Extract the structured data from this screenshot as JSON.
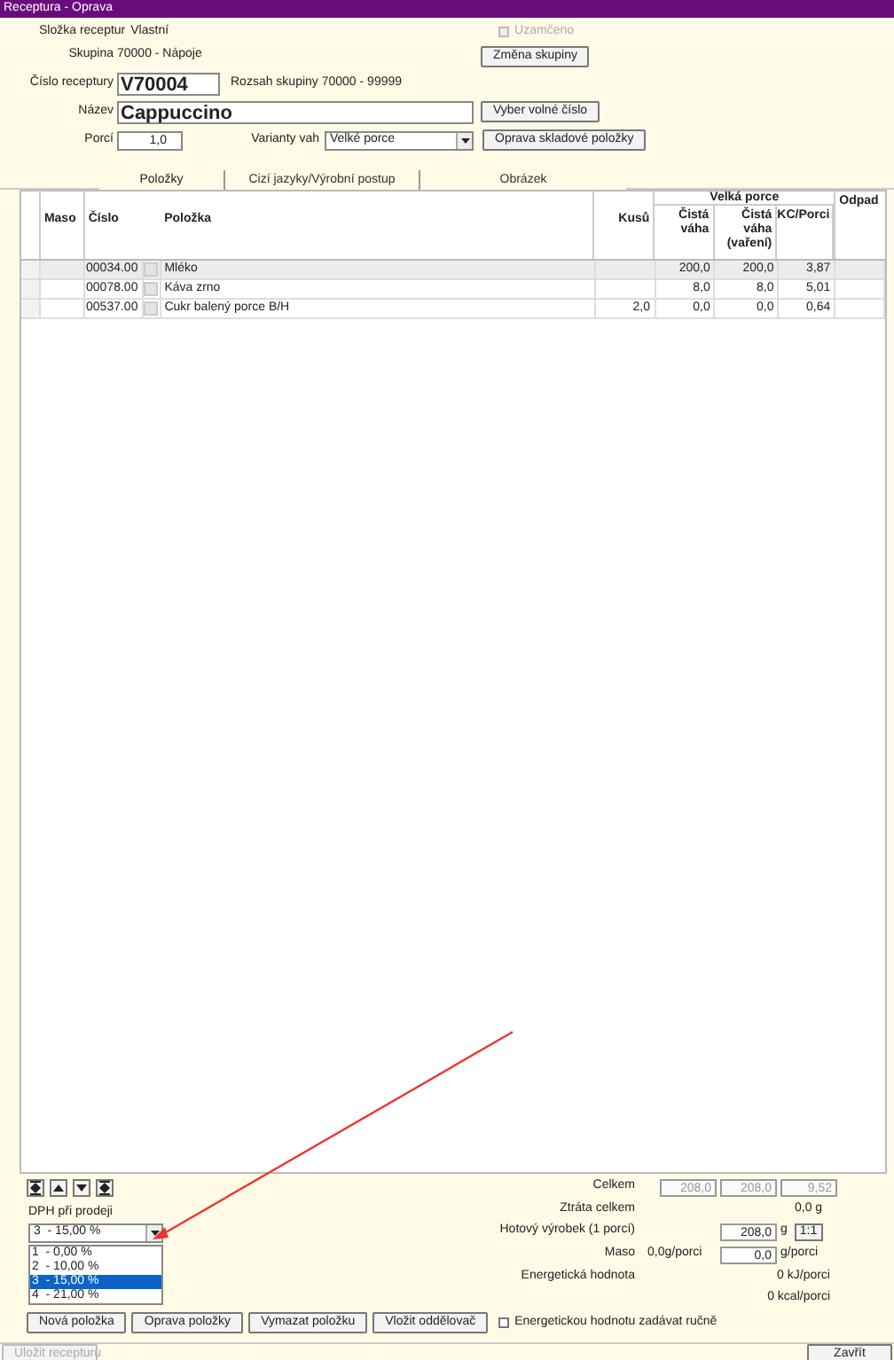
{
  "window": {
    "title": "Receptura - Oprava"
  },
  "header": {
    "folder_label": "Složka receptur",
    "folder_value": "Vlastní",
    "locked": {
      "label": "Uzamčeno",
      "checked": false,
      "disabled": true
    },
    "group_label": "Skupina",
    "group_value": "70000 - Nápoje",
    "change_group_button": "Změna skupiny",
    "number_label": "Číslo receptury",
    "number_value": "V70004",
    "range_text": "Rozsah skupiny 70000 - 99999",
    "name_label": "Název",
    "name_value": "Cappuccino",
    "free_number_button": "Vyber volné číslo",
    "portions_label": "Porcí",
    "portions_value": "1,0",
    "variants_label": "Varianty vah",
    "variants_value": "Velké porce",
    "stock_item_button": "Oprava skladové položky"
  },
  "tabs": [
    {
      "label": "Položky",
      "selected": true
    },
    {
      "label": "Cizí jazyky/Výrobní postup",
      "selected": false
    },
    {
      "label": "Obrázek",
      "selected": false
    }
  ],
  "table": {
    "group_header": "Velká porce",
    "columns": [
      "Maso",
      "Číslo",
      "Položka",
      "Kusů",
      "Čistá váha",
      "Čistá váha (vaření)",
      "KC/Porci",
      "Odpad"
    ],
    "rows": [
      {
        "number": "00034.00",
        "item": "Mléko",
        "pieces": "",
        "net": "200,0",
        "net_cooked": "200,0",
        "kc": "3,87",
        "selected": true
      },
      {
        "number": "00078.00",
        "item": "Káva zrno",
        "pieces": "",
        "net": "8,0",
        "net_cooked": "8,0",
        "kc": "5,01",
        "selected": false
      },
      {
        "number": "00537.00",
        "item": "Cukr balený porce B/H",
        "pieces": "2,0",
        "net": "0,0",
        "net_cooked": "0,0",
        "kc": "0,64",
        "selected": false
      }
    ]
  },
  "totals": {
    "total_label": "Celkem",
    "total_values": [
      "208,0",
      "208,0",
      "9,52"
    ],
    "loss_label": "Ztráta celkem",
    "loss_value": "0,0 g",
    "finished_label": "Hotový výrobek (1 porcí)",
    "finished_value": "208,0",
    "finished_unit": "g",
    "ratio_button": "1:1",
    "meat_label": "Maso",
    "meat_value": "0,0g/porci",
    "meat_field": "0,0",
    "meat_unit": "g/porci",
    "energy_label": "Energetická hodnota",
    "energy_kj": "0 kJ/porci",
    "energy_kcal": "0 kcal/porci"
  },
  "vat": {
    "label": "DPH při prodeji",
    "value": "3  - 15,00 %",
    "options": [
      {
        "label": "1  - 0,00 %",
        "selected": false
      },
      {
        "label": "2  - 10,00 %",
        "selected": false
      },
      {
        "label": "3  - 15,00 %",
        "selected": true
      },
      {
        "label": "4  - 21,00 %",
        "selected": false
      }
    ]
  },
  "buttons": [
    "Nová položka",
    "Oprava položky",
    "Vymazat položku",
    "Vložit oddělovač"
  ],
  "manual_energy": {
    "label": "Energetickou hodnotu zadávat ručně",
    "checked": false
  },
  "save_button": {
    "label": "Uložit recepturu",
    "disabled": true
  },
  "close_button": "Zavřít"
}
